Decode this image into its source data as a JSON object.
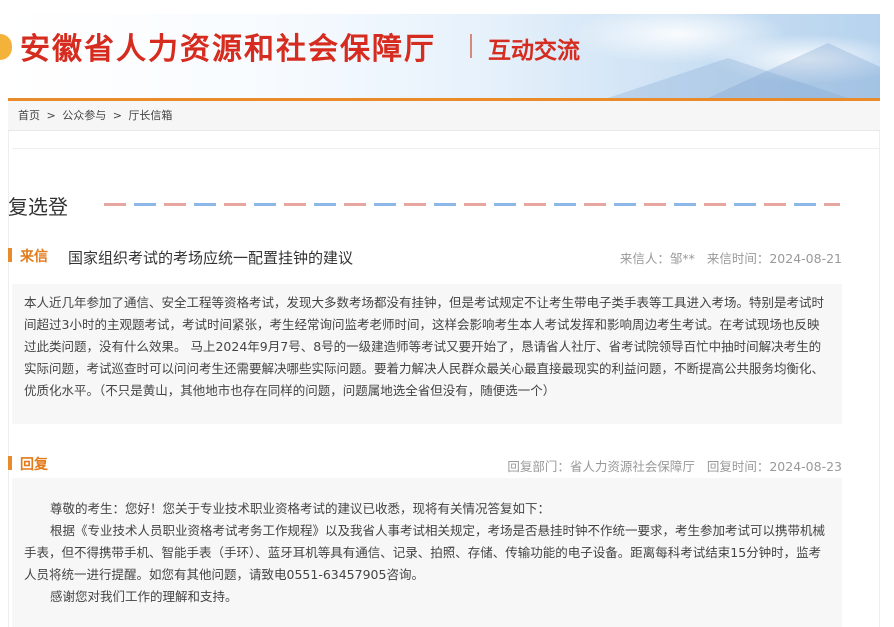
{
  "header": {
    "site_title": "安徽省人力资源和社会保障厅",
    "section_title": "互动交流"
  },
  "breadcrumb": {
    "home": "首页",
    "sep1": ">",
    "level2": "公众参与",
    "sep2": ">",
    "level3": "厅长信箱"
  },
  "page_heading": "复选登",
  "letter": {
    "tag": "来信",
    "title": "国家组织考试的考场应统一配置挂钟的建议",
    "sender_label": "来信人：",
    "sender": "邹**",
    "date_label": "来信时间：",
    "date": "2024-08-21",
    "paragraphs": [
      "本人近几年参加了通信、安全工程等资格考试，发现大多数考场都没有挂钟，但是考试规定不让考生带电子类手表等工具进入考场。特别是考试时间超过3小时的主观题考试，考试时间紧张，考生经常询问监考老师时间，这样会影响考生本人考试发挥和影响周边考生考试。在考试现场也反映过此类问题，没有什么效果。 马上2024年9月7号、8号的一级建造师等考试又要开始了，恳请省人社厅、省考试院领导百忙中抽时间解决考生的实际问题，考试巡查时可以问问考生还需要解决哪些实际问题。要着力解决人民群众最关心最直接最现实的利益问题，不断提高公共服务均衡化、优质化水平。（不只是黄山，其他地市也存在同样的问题，问题属地选全省但没有，随便选一个）"
    ]
  },
  "reply": {
    "tag": "回复",
    "dept_label": "回复部门：",
    "dept": "省人力资源社会保障厅",
    "date_label": "回复时间：",
    "date": "2024-08-23",
    "greeting": "尊敬的考生：您好！您关于专业技术职业资格考试的建议已收悉，现将有关情况答复如下：",
    "body": "根据《专业技术人员职业资格考试考务工作规程》以及我省人事考试相关规定，考场是否悬挂时钟不作统一要求，考生参加考试可以携带机械手表，但不得携带手机、智能手表（手环）、蓝牙耳机等具有通信、记录、拍照、存储、传输功能的电子设备。距离每科考试结束15分钟时，监考人员将统一进行提醒。如您有其他问题，请致电0551-63457905咨询。",
    "closing": "感谢您对我们工作的理解和支持。"
  },
  "colors": {
    "title_red": "#d62c1f",
    "accent_orange": "#e98a2b",
    "meta_gray": "#999999",
    "box_bg": "#f7f7f7"
  }
}
